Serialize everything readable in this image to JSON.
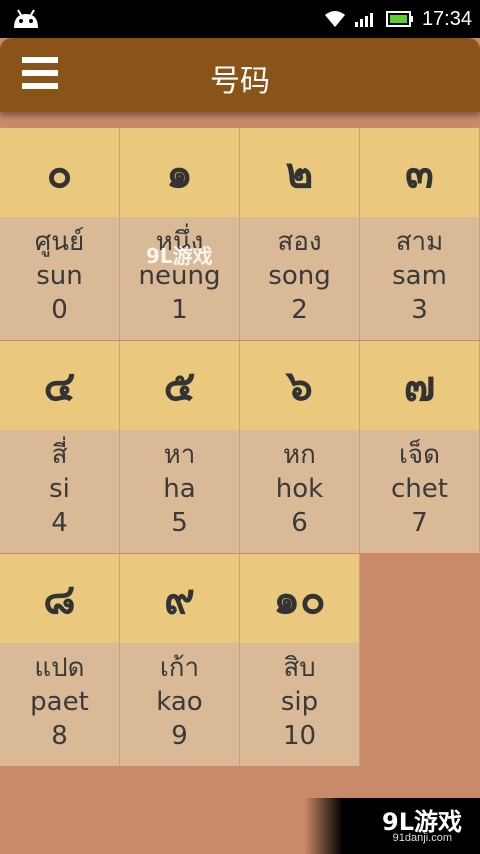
{
  "status_bar": {
    "time": "17:34",
    "icons": [
      "android-icon",
      "wifi-icon",
      "signal-icon",
      "battery-icon"
    ]
  },
  "app_bar": {
    "title": "号码",
    "menu_icon": "hamburger-menu-icon"
  },
  "numbers": [
    {
      "numeral": "๐",
      "thai": "ศูนย์",
      "roman": "sun",
      "arabic": "0"
    },
    {
      "numeral": "๑",
      "thai": "หนึ่ง",
      "roman": "neung",
      "arabic": "1"
    },
    {
      "numeral": "๒",
      "thai": "สอง",
      "roman": "song",
      "arabic": "2"
    },
    {
      "numeral": "๓",
      "thai": "สาม",
      "roman": "sam",
      "arabic": "3"
    },
    {
      "numeral": "๔",
      "thai": "สี่",
      "roman": "si",
      "arabic": "4"
    },
    {
      "numeral": "๕",
      "thai": "หา",
      "roman": "ha",
      "arabic": "5"
    },
    {
      "numeral": "๖",
      "thai": "หก",
      "roman": "hok",
      "arabic": "6"
    },
    {
      "numeral": "๗",
      "thai": "เจ็ด",
      "roman": "chet",
      "arabic": "7"
    },
    {
      "numeral": "๘",
      "thai": "แปด",
      "roman": "paet",
      "arabic": "8"
    },
    {
      "numeral": "๙",
      "thai": "เก้า",
      "roman": "kao",
      "arabic": "9"
    },
    {
      "numeral": "๑๐",
      "thai": "สิบ",
      "roman": "sip",
      "arabic": "10"
    }
  ],
  "watermark": {
    "small": "9L游戏",
    "big": "9L游戏",
    "url": "91danji.com"
  },
  "colors": {
    "appbar": "#8a5317",
    "numeral_bg": "#eac97e",
    "word_bg": "#d9b996",
    "background": "#c98a69"
  }
}
